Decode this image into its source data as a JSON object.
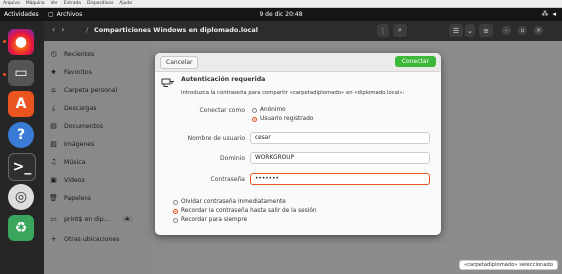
{
  "vbox_menu": [
    "Arquivo",
    "Máquina",
    "Ver",
    "Entrada",
    "Dispositivos",
    "Ajuda"
  ],
  "topbar": {
    "activities": "Actividades",
    "app_name": "Archivos",
    "clock": "9 de dic 20:48"
  },
  "files": {
    "path": "Comparticiones Windows en diplomado.local",
    "sidebar": [
      {
        "icon": "◷",
        "label": "Recientes"
      },
      {
        "icon": "★",
        "label": "Favoritos"
      },
      {
        "icon": "⌂",
        "label": "Carpeta personal"
      },
      {
        "icon": "⤓",
        "label": "Descargas"
      },
      {
        "icon": "▤",
        "label": "Documentos"
      },
      {
        "icon": "▨",
        "label": "Imágenes"
      },
      {
        "icon": "♫",
        "label": "Música"
      },
      {
        "icon": "▣",
        "label": "Vídeos"
      },
      {
        "icon": "🗑",
        "label": "Papelera"
      },
      {
        "icon": "▭",
        "label": "print$ en dip…"
      },
      {
        "icon": "+",
        "label": "Otras ubicaciones"
      }
    ],
    "status": "«carpetadiplomado» seleccionado"
  },
  "dialog": {
    "cancel": "Cancelar",
    "connect": "Conectar",
    "title": "Autenticación requerida",
    "description": "Introduzca la contraseña para compartir «carpetadiplomado» en «diplomado.local»:",
    "connect_as_label": "Conectar como",
    "anonymous": "Anónimo",
    "registered": "Usuario registrado",
    "username_label": "Nombre de usuario",
    "username": "cesar",
    "domain_label": "Dominio",
    "domain": "WORKGROUP",
    "password_label": "Contraseña",
    "password": "•••••••",
    "forget": "Olvidar contraseña inmediatamente",
    "remember_session": "Recordar la contraseña hasta salir de la sesión",
    "remember_forever": "Recordar para siempre"
  }
}
